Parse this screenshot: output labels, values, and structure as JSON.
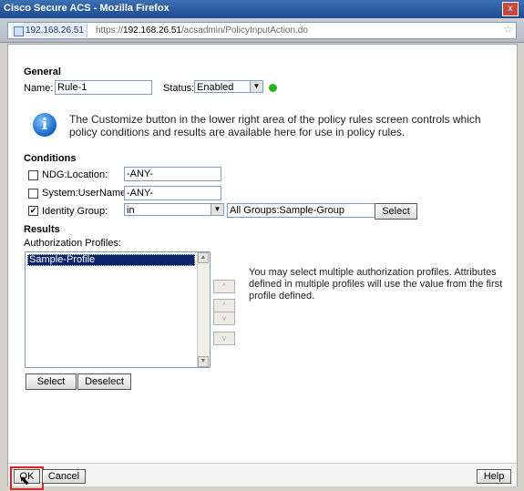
{
  "window": {
    "title": "Cisco Secure ACS - Mozilla Firefox",
    "close_glyph": "x"
  },
  "urlbar": {
    "site": "192.168.26.51",
    "url_prefix": "https://",
    "url_host": "192.168.26.51",
    "url_path": "/acsadmin/PolicyInputAction.do",
    "star_glyph": "☆"
  },
  "general": {
    "heading": "General",
    "name_label": "Name:",
    "name_value": "Rule-1",
    "status_label": "Status:",
    "status_value": "Enabled",
    "status_color": "#2ab31f"
  },
  "info_icon_glyph": "i",
  "info_text": "The Customize button in the lower right area of the policy rules screen controls which policy conditions and results are available here for use in policy rules.",
  "conditions": {
    "heading": "Conditions",
    "rows": [
      {
        "label": "NDG:Location:",
        "checked": false,
        "value": "-ANY-"
      },
      {
        "label": "System:UserName:",
        "checked": false,
        "value": "-ANY-"
      },
      {
        "label": "Identity Group:",
        "checked": true,
        "operator": "in",
        "value": "All Groups:Sample-Group",
        "button": "Select"
      }
    ]
  },
  "results": {
    "heading": "Results",
    "profiles_label": "Authorization Profiles:",
    "profiles": [
      "Sample-Profile"
    ],
    "hint": "You may select multiple authorization profiles. Attributes defined in multiple profiles will use the value from the first profile defined.",
    "select_button": "Select",
    "deselect_button": "Deselect",
    "move_glyphs": [
      "^",
      "^",
      "v",
      "v"
    ]
  },
  "footer": {
    "ok": "OK",
    "cancel": "Cancel",
    "help": "Help",
    "cursor_glyph": "⬉"
  },
  "check_glyph": "✔"
}
